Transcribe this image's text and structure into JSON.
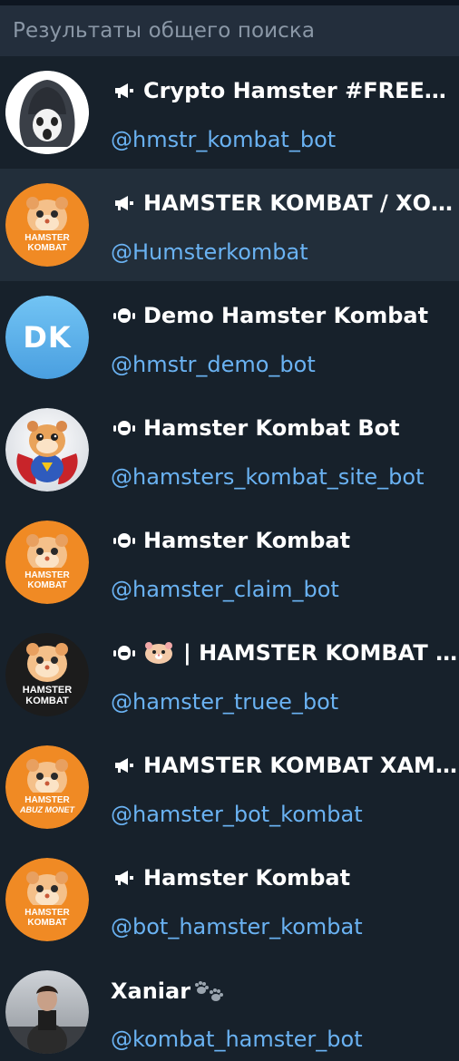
{
  "header": {
    "title": "Результаты общего поиска"
  },
  "colors": {
    "background": "#17212b",
    "header_bg": "#232e3c",
    "selected_row": "#222e3a",
    "username": "#6ab2f2",
    "title": "#ffffff",
    "avatar_orange": "#f08a24"
  },
  "results": [
    {
      "type_icon": "megaphone-icon",
      "title": "Crypto Hamster #FREEDU...",
      "username": "@hmstr_kombat_bot",
      "avatar": "hooded-figure"
    },
    {
      "type_icon": "megaphone-icon",
      "title": "HAMSTER KOMBAT / ХОМ...",
      "username": "@Humsterkombat",
      "avatar": "hamster-kombat",
      "avatar_caption": [
        "HAMSTER",
        "KOMBAT"
      ]
    },
    {
      "type_icon": "bot-icon",
      "title": "Demo Hamster Kombat",
      "username": "@hmstr_demo_bot",
      "avatar": "initials",
      "initials": "DK"
    },
    {
      "type_icon": "bot-icon",
      "title": "Hamster Kombat Bot",
      "username": "@hamsters_kombat_site_bot",
      "avatar": "superhero-hamster"
    },
    {
      "type_icon": "bot-icon",
      "title": "Hamster Kombat",
      "username": "@hamster_claim_bot",
      "avatar": "hamster-kombat",
      "avatar_caption": [
        "HAMSTER",
        "KOMBAT"
      ]
    },
    {
      "type_icon": "bot-icon",
      "title": "| HAMSTER KOMBAT |...",
      "username": "@hamster_truee_bot",
      "avatar": "hamster-kombat-dark",
      "avatar_caption": [
        "HAMSTER",
        "KOMBAT"
      ],
      "emoji": "hamster-emoji"
    },
    {
      "type_icon": "megaphone-icon",
      "title": "HAMSTER KOMBAT ХАМСТ...",
      "username": "@hamster_bot_kombat",
      "avatar": "hamster-kombat",
      "avatar_caption": [
        "HAMSTER",
        "ABUZ MONET"
      ]
    },
    {
      "type_icon": "megaphone-icon",
      "title": "Hamster Kombat",
      "username": "@bot_hamster_kombat",
      "avatar": "hamster-kombat",
      "avatar_caption": [
        "HAMSTER",
        "KOMBAT"
      ]
    },
    {
      "type_icon": "none",
      "title": "Xaniar",
      "username": "@kombat_hamster_bot",
      "avatar": "person-photo",
      "suffix_icon": "paws-icon"
    }
  ]
}
